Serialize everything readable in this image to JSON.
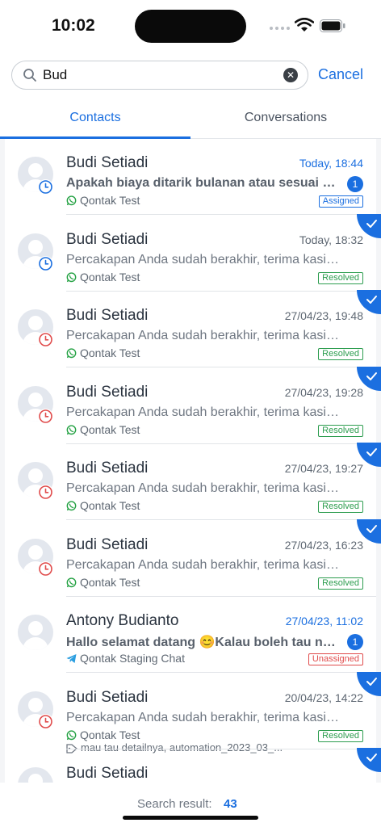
{
  "status": {
    "time": "10:02"
  },
  "search": {
    "value": "Bud",
    "cancel_label": "Cancel"
  },
  "tabs": [
    {
      "label": "Contacts",
      "active": true
    },
    {
      "label": "Conversations",
      "active": false
    }
  ],
  "rows": [
    {
      "name": "Budi Setiadi",
      "datetime": "Today, 18:44",
      "message": "Apakah biaya ditarik bulanan atau sesuai p...",
      "channel": "Qontak Test",
      "channel_icon": "whatsapp-icon",
      "status": "Assigned",
      "unread": "1",
      "clock": "blue",
      "checked": false,
      "tags": ""
    },
    {
      "name": "Budi Setiadi",
      "datetime": "Today, 18:32",
      "message": "Percakapan Anda sudah berakhir, terima kasih tela...",
      "channel": "Qontak Test",
      "channel_icon": "whatsapp-icon",
      "status": "Resolved",
      "unread": "",
      "clock": "blue",
      "checked": true,
      "tags": ""
    },
    {
      "name": "Budi Setiadi",
      "datetime": "27/04/23, 19:48",
      "message": "Percakapan Anda sudah berakhir, terima kasih tela...",
      "channel": "Qontak Test",
      "channel_icon": "whatsapp-icon",
      "status": "Resolved",
      "unread": "",
      "clock": "red",
      "checked": true,
      "tags": ""
    },
    {
      "name": "Budi Setiadi",
      "datetime": "27/04/23, 19:28",
      "message": "Percakapan Anda sudah berakhir, terima kasih tela...",
      "channel": "Qontak Test",
      "channel_icon": "whatsapp-icon",
      "status": "Resolved",
      "unread": "",
      "clock": "red",
      "checked": true,
      "tags": ""
    },
    {
      "name": "Budi Setiadi",
      "datetime": "27/04/23, 19:27",
      "message": "Percakapan Anda sudah berakhir, terima kasih tela...",
      "channel": "Qontak Test",
      "channel_icon": "whatsapp-icon",
      "status": "Resolved",
      "unread": "",
      "clock": "red",
      "checked": true,
      "tags": ""
    },
    {
      "name": "Budi Setiadi",
      "datetime": "27/04/23, 16:23",
      "message": "Percakapan Anda sudah berakhir, terima kasih tela...",
      "channel": "Qontak Test",
      "channel_icon": "whatsapp-icon",
      "status": "Resolved",
      "unread": "",
      "clock": "red",
      "checked": true,
      "tags": ""
    },
    {
      "name": "Antony Budianto",
      "datetime": "27/04/23, 11:02",
      "message": "Hallo selamat datang 😊Kalau boleh tau na...",
      "channel": "Qontak Staging Chat",
      "channel_icon": "telegram-icon",
      "status": "Unassigned",
      "unread": "1",
      "clock": "",
      "checked": false,
      "tags": ""
    },
    {
      "name": "Budi Setiadi",
      "datetime": "20/04/23, 14:22",
      "message": "Percakapan Anda sudah berakhir, terima kasih tela...",
      "channel": "Qontak Test",
      "channel_icon": "whatsapp-icon",
      "status": "Resolved",
      "unread": "",
      "clock": "red",
      "checked": true,
      "tags": "mau tau detailnya, automation_2023_03_..."
    },
    {
      "name": "Budi Setiadi",
      "datetime": "",
      "message": "",
      "channel": "",
      "channel_icon": "",
      "status": "",
      "unread": "",
      "clock": "",
      "checked": true,
      "tags": ""
    }
  ],
  "footer": {
    "label": "Search result:",
    "count": "43"
  },
  "colors": {
    "accent": "#1b6fe0",
    "resolved": "#2d9d4f",
    "unassigned": "#e04b4b",
    "overdue": "#e04b4b"
  }
}
